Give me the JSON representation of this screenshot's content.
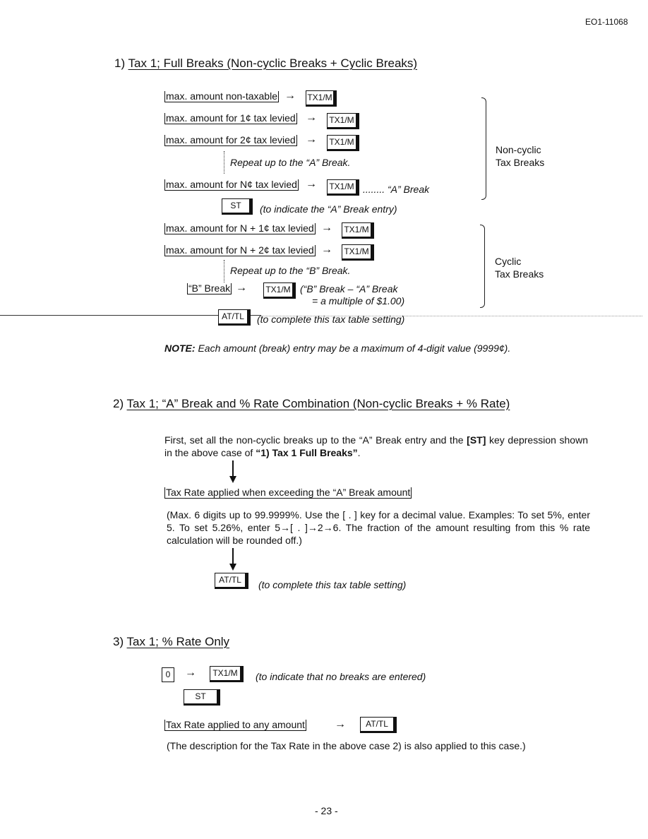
{
  "header": {
    "doc_id": "EO1-11068"
  },
  "section1": {
    "number": "1)",
    "title": "Tax 1; Full Breaks (Non-cyclic Breaks + Cyclic Breaks)",
    "rows": [
      {
        "entry": "max. amount non-taxable",
        "key": "TX1/M"
      },
      {
        "entry": "max. amount for 1¢ tax levied",
        "key": "TX1/M"
      },
      {
        "entry": "max. amount for 2¢ tax levied",
        "key": "TX1/M"
      },
      {
        "entry": "max. amount for N¢ tax levied",
        "key": "TX1/M",
        "note": "........ “A” Break"
      },
      {
        "entry": "max. amount for N + 1¢ tax levied",
        "key": "TX1/M"
      },
      {
        "entry": "max. amount for N + 2¢ tax levied",
        "key": "TX1/M"
      },
      {
        "entry": "“B” Break",
        "key": "TX1/M",
        "note": "(“B” Break – “A” Break",
        "note2": "= a multiple of $1.00)"
      }
    ],
    "repeat_a": "Repeat up to the “A” Break.",
    "repeat_b": "Repeat up to the “B” Break.",
    "arrow": "→",
    "st_key": "ST",
    "st_note": "(to indicate the “A” Break entry)",
    "attl_key": "AT/TL",
    "attl_note": "(to complete this tax table setting)",
    "noncyclic_label": [
      "Non-cyclic",
      "Tax Breaks"
    ],
    "cyclic_label": [
      "Cyclic",
      "Tax Breaks"
    ],
    "note_label": "NOTE:",
    "note_text": "Each amount (break) entry may be a maximum of 4-digit value (9999¢)."
  },
  "section2": {
    "number": "2)",
    "title": "Tax 1; “A” Break and % Rate Combination (Non-cyclic Breaks + % Rate)",
    "para1a": "First, set all the non-cyclic breaks up to the “A” Break entry and the ",
    "para1b": "[ST]",
    "para1c": " key depression shown in the above case of ",
    "para1d": "“1) Tax 1 Full Breaks”",
    "para1e": ".",
    "entry": "Tax Rate applied when exceeding the “A” Break amount",
    "para2": "(Max. 6 digits up to 99.9999%.  Use the [ . ] key for a decimal value.  Examples:  To set 5%, enter 5.  To set 5.26%, enter 5→[ . ]→2→6.  The fraction of the amount resulting from this % rate calculation will be rounded off.)",
    "attl_key": "AT/TL",
    "attl_note": "(to complete this tax table setting)"
  },
  "section3": {
    "number": "3)",
    "title": "Tax 1; % Rate Only",
    "zero_key": "0",
    "tx_key": "TX1/M",
    "tx_note": "(to indicate that no breaks are entered)",
    "st_key": "ST",
    "entry": "Tax Rate applied to any amount",
    "attl_key": "AT/TL",
    "para": "(The description for the Tax Rate in the above case 2) is also applied to this case.)"
  },
  "footer": {
    "page": "- 23 -"
  }
}
